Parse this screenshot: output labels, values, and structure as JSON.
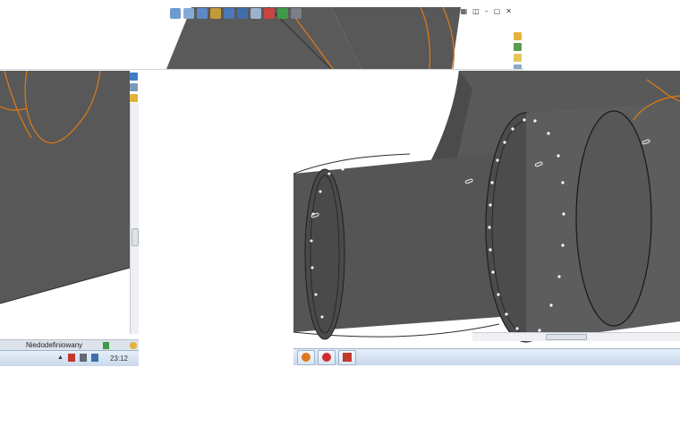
{
  "statusbar": {
    "state": "Niedodefiniowany"
  },
  "taskbar": {
    "clock": "23:12",
    "tray_icons": [
      "up-arrow-icon",
      "network-icon",
      "speaker-icon",
      "volume-icon"
    ],
    "task_buttons": [
      "firefox-icon",
      "opera-icon",
      "solidworks-icon"
    ]
  },
  "toolbar": {
    "icons": [
      "zoom-fit-icon",
      "zoom-area-icon",
      "rotate-icon",
      "section-view-icon",
      "view-orientation-icon",
      "display-style-icon",
      "hide-show-icon",
      "edit-appearance-icon",
      "scene-icon",
      "view-settings-icon"
    ]
  },
  "window_controls": [
    "tile-icon",
    "restore-icon",
    "minimize-icon",
    "maximize-icon",
    "close-icon"
  ],
  "taskpane_icons": [
    "resources-icon",
    "design-library-icon",
    "file-explorer-icon",
    "appearances-icon"
  ],
  "colors": {
    "model_body": "#5a5a5a",
    "model_dark": "#3f3f3f",
    "model_light": "#6b6b6b",
    "curve_orange": "#e07b14",
    "status_bg": "#dde3ea",
    "taskbar_bg": "#d4e1f1"
  }
}
